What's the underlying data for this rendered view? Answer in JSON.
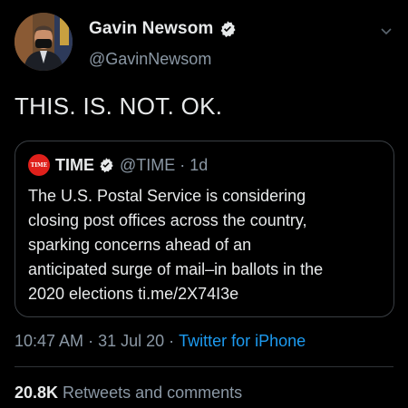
{
  "author": {
    "display_name": "Gavin Newsom",
    "handle": "@GavinNewsom",
    "verified_icon": "verified-badge-icon"
  },
  "tweet": {
    "text": "THIS. IS. NOT. OK."
  },
  "quoted_tweet": {
    "logo_text": "TIME",
    "display_name": "TIME",
    "handle": "@TIME",
    "separator": "·",
    "time_ago": "1d",
    "body_lines": [
      "The U.S. Postal Service is considering",
      "closing post offices across the country,",
      "sparking concerns ahead of an",
      "anticipated surge of mail–in ballots in the",
      "2020 elections ti.me/2X74I3e"
    ]
  },
  "meta": {
    "time": "10:47 AM",
    "date": "31 Jul 20",
    "separator": "·",
    "source": "Twitter for iPhone"
  },
  "stats": {
    "count": "20.8K",
    "label": "Retweets and comments"
  },
  "colors": {
    "background": "#000000",
    "text_primary": "#e7e9ea",
    "text_secondary": "#8b98a5",
    "link": "#1d9bf0",
    "verified": "#e7e9ea",
    "time_logo": "#e0201b"
  }
}
